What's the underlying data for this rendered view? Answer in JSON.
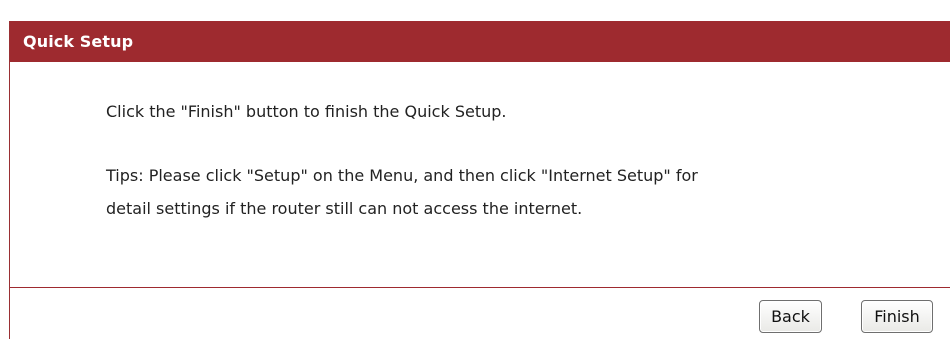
{
  "panel": {
    "title": "Quick Setup"
  },
  "message": {
    "line1": "Click the \"Finish\" button to finish the Quick Setup.",
    "line2": "Tips: Please click \"Setup\" on the Menu, and then click \"Internet Setup\" for",
    "line3": "detail settings if the router still can not access the internet."
  },
  "buttons": {
    "back_label": "Back",
    "finish_label": "Finish"
  },
  "colors": {
    "header_bg": "#9e2a2f",
    "header_text": "#ffffff",
    "divider": "#9e2a2f"
  }
}
